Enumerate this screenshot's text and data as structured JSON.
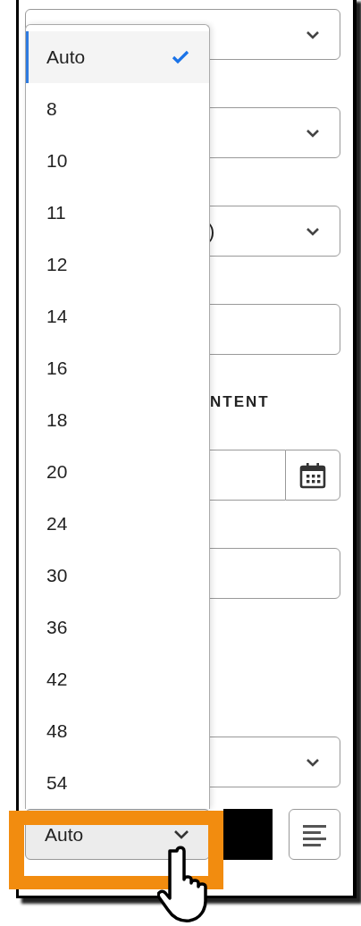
{
  "form": {
    "fields": [
      {
        "kind": "select"
      },
      {
        "kind": "select"
      },
      {
        "kind": "select",
        "value": ")"
      },
      {
        "kind": "input"
      },
      {
        "kind": "label",
        "text": "NTENT"
      },
      {
        "kind": "date"
      },
      {
        "kind": "input"
      },
      {
        "kind": "select"
      }
    ]
  },
  "toolbar": {
    "size_button": {
      "value": "Auto"
    }
  },
  "size_menu": {
    "options": [
      {
        "label": "Auto",
        "selected": true
      },
      {
        "label": "8",
        "selected": false
      },
      {
        "label": "10",
        "selected": false
      },
      {
        "label": "11",
        "selected": false
      },
      {
        "label": "12",
        "selected": false
      },
      {
        "label": "14",
        "selected": false
      },
      {
        "label": "16",
        "selected": false
      },
      {
        "label": "18",
        "selected": false
      },
      {
        "label": "20",
        "selected": false
      },
      {
        "label": "24",
        "selected": false
      },
      {
        "label": "30",
        "selected": false
      },
      {
        "label": "36",
        "selected": false
      },
      {
        "label": "42",
        "selected": false
      },
      {
        "label": "48",
        "selected": false
      },
      {
        "label": "54",
        "selected": false
      }
    ]
  }
}
